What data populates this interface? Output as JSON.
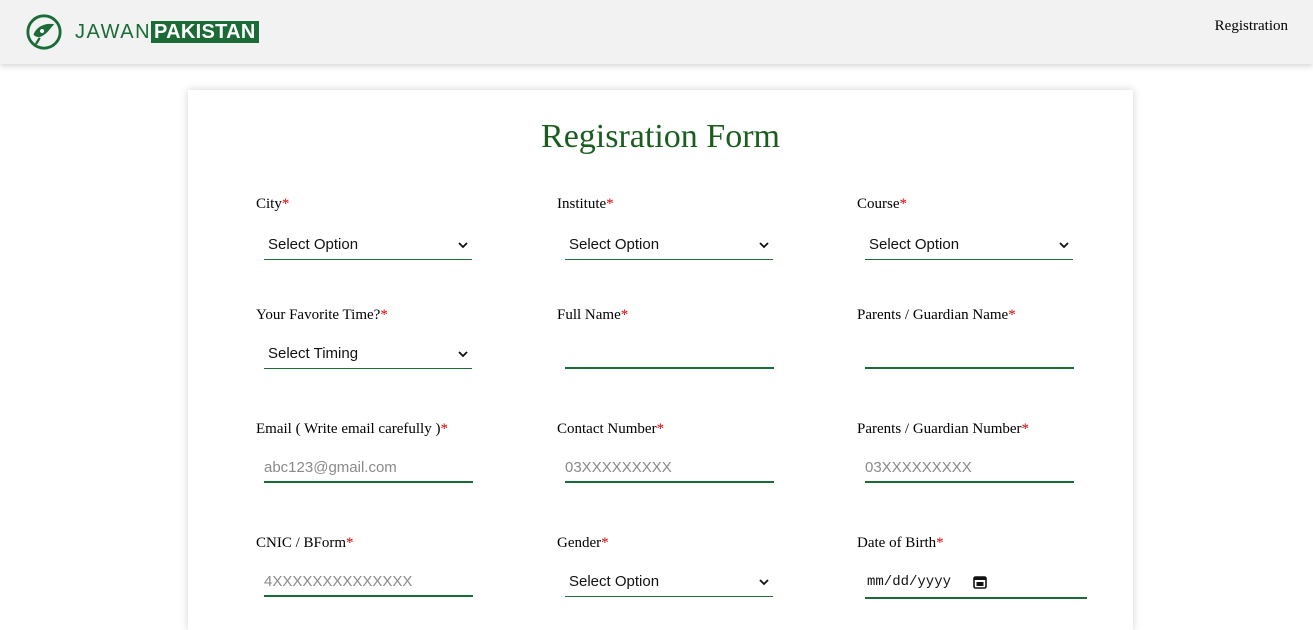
{
  "nav": {
    "brand_left": "JAWAN",
    "brand_right": "PAKISTAN",
    "link_registration": "Registration"
  },
  "form": {
    "title": "Regisration Form",
    "required_mark": "*",
    "fields": {
      "city": {
        "label": "City",
        "value": "Select Option"
      },
      "institute": {
        "label": "Institute",
        "value": "Select Option"
      },
      "course": {
        "label": "Course",
        "value": "Select Option"
      },
      "favorite_time": {
        "label": "Your Favorite Time?",
        "value": "Select Timing"
      },
      "full_name": {
        "label": "Full Name",
        "value": "",
        "placeholder": ""
      },
      "parent_name": {
        "label": "Parents / Guardian Name",
        "value": "",
        "placeholder": ""
      },
      "email": {
        "label": "Email ( Write email carefully )",
        "value": "",
        "placeholder": "abc123@gmail.com"
      },
      "contact": {
        "label": "Contact Number",
        "value": "",
        "placeholder": "03XXXXXXXXX"
      },
      "parent_number": {
        "label": "Parents / Guardian Number",
        "value": "",
        "placeholder": "03XXXXXXXXX"
      },
      "cnic": {
        "label": "CNIC / BForm",
        "value": "",
        "placeholder": "4XXXXXXXXXXXXXX"
      },
      "gender": {
        "label": "Gender",
        "value": "Select Option"
      },
      "dob": {
        "label": "Date of Birth",
        "value": "mm/dd/yyyy"
      }
    }
  },
  "colors": {
    "brand_green": "#1a6b36",
    "title_green": "#1a5e1f",
    "required_red": "#d40000",
    "navbar_bg": "#f2f2f2"
  },
  "icons": {
    "logo": "jawan-pakistan-logo-icon",
    "dropdown": "chevron-down-icon",
    "calendar": "calendar-icon"
  }
}
